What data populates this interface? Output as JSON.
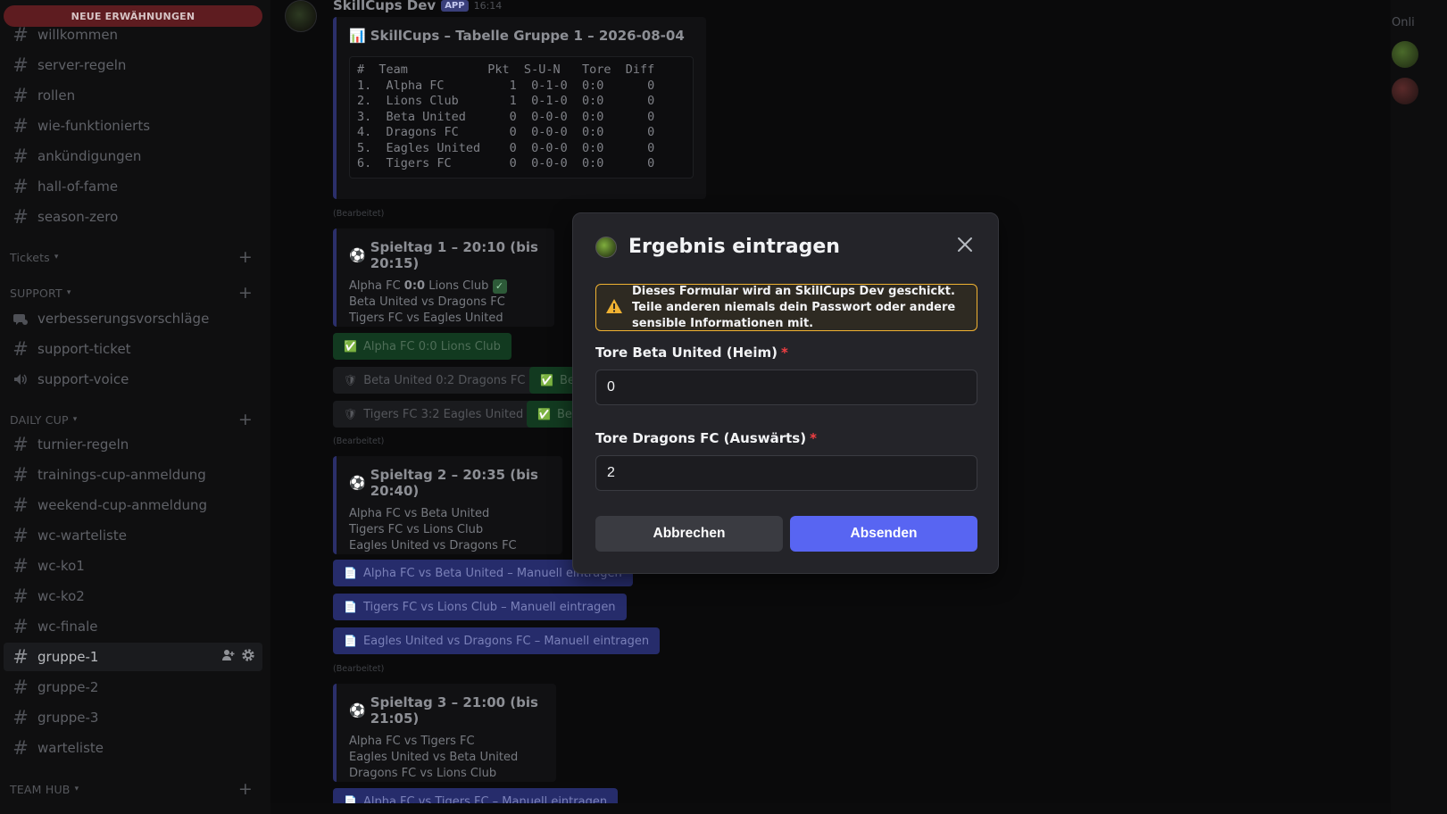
{
  "sidebar": {
    "mention_pill": "NEUE ERWÄHNUNGEN",
    "channels_top": [
      "willkommen",
      "server-regeln",
      "rollen",
      "wie-funktionierts",
      "ankündigungen",
      "hall-of-fame",
      "season-zero"
    ],
    "cat_tickets": "Tickets",
    "cat_support": "SUPPORT",
    "support_channels": [
      "verbesserungsvorschläge",
      "support-ticket",
      "support-voice"
    ],
    "cat_daily_cup": "DAILY CUP",
    "daily_channels": [
      "turnier-regeln",
      "trainings-cup-anmeldung",
      "weekend-cup-anmeldung",
      "wc-warteliste",
      "wc-ko1",
      "wc-ko2",
      "wc-finale",
      "gruppe-1",
      "gruppe-2",
      "gruppe-3",
      "warteliste"
    ],
    "active_channel": "gruppe-1",
    "cat_team_hub": "TEAM HUB"
  },
  "chat": {
    "author": "SkillCups Dev",
    "app_badge": "APP",
    "timestamp": "16:14",
    "table_title": "SkillCups – Tabelle Gruppe 1 – 2026-08-04",
    "table_text": "#  Team           Pkt  S-U-N   Tore  Diff\n1.  Alpha FC         1  0-1-0  0:0      0\n2.  Lions Club       1  0-1-0  0:0      0\n3.  Beta United      0  0-0-0  0:0      0\n4.  Dragons FC       0  0-0-0  0:0      0\n5.  Eagles United    0  0-0-0  0:0      0\n6.  Tigers FC        0  0-0-0  0:0      0",
    "edited": "(Bearbeitet)",
    "md1": {
      "title": "Spieltag 1 – 20:10 (bis 20:15)",
      "line1_a": "Alpha FC ",
      "line1_score": "0:0",
      "line1_b": " Lions Club",
      "line2": "Beta United vs Dragons FC",
      "line3": "Tigers FC vs Eagles United"
    },
    "md1_buttons": {
      "b1": "Alpha FC 0:0 Lions Club",
      "b2": "Beta United 0:2 Dragons FC",
      "b3": "Be",
      "b4": "Tigers FC 3:2 Eagles United",
      "b5": "Be"
    },
    "md2": {
      "title": "Spieltag 2 – 20:35 (bis 20:40)",
      "line1": "Alpha FC vs Beta United",
      "line2": "Tigers FC vs Lions Club",
      "line3": "Eagles United vs Dragons FC"
    },
    "md2_buttons": [
      "Alpha FC vs Beta United – Manuell eintragen",
      "Tigers FC vs Lions Club – Manuell eintragen",
      "Eagles United vs Dragons FC – Manuell eintragen"
    ],
    "md3": {
      "title": "Spieltag 3 – 21:00 (bis 21:05)",
      "line1": "Alpha FC vs Tigers FC",
      "line2": "Eagles United vs Beta United",
      "line3": "Dragons FC vs Lions Club"
    },
    "md3_button": "Alpha FC vs Tigers FC – Manuell eintragen"
  },
  "members": {
    "online_label": "Onli"
  },
  "modal": {
    "title": "Ergebnis eintragen",
    "warning": "Dieses Formular wird an SkillCups Dev geschickt. Teile anderen niemals dein Passwort oder andere sensible Informationen mit.",
    "home_label": "Tore Beta United (Heim)",
    "home_value": "0",
    "away_label": "Tore Dragons FC (Auswärts)",
    "away_value": "2",
    "required_mark": "*",
    "cancel": "Abbrechen",
    "submit": "Absenden"
  },
  "colors": {
    "accent": "#5865f2",
    "warning": "#f0b232",
    "required": "#f23f43",
    "success": "#2d7d46"
  }
}
